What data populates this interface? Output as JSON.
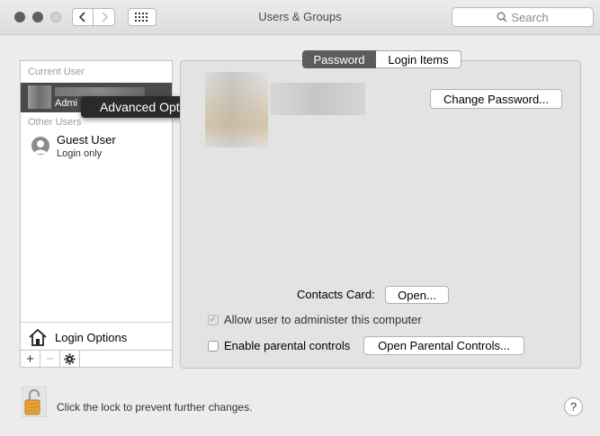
{
  "window": {
    "title": "Users & Groups",
    "search_placeholder": "Search"
  },
  "sidebar": {
    "current_user_header": "Current User",
    "current_user_role": "Admi",
    "other_users_header": "Other Users",
    "guest_name": "Guest User",
    "guest_sub": "Login only",
    "login_options_label": "Login Options",
    "add_symbol": "+",
    "remove_symbol": "−"
  },
  "context_menu": {
    "item": "Advanced Options..."
  },
  "tabs": [
    {
      "label": "Password",
      "active": true
    },
    {
      "label": "Login Items",
      "active": false
    }
  ],
  "panel": {
    "change_password_label": "Change Password...",
    "contacts_card_label": "Contacts Card:",
    "open_label": "Open...",
    "allow_admin_label": "Allow user to administer this computer",
    "allow_admin_checked": true,
    "parental_controls_label": "Enable parental controls",
    "parental_controls_checked": false,
    "open_parental_label": "Open Parental Controls..."
  },
  "footer": {
    "lock_text": "Click the lock to prevent further changes.",
    "help_symbol": "?"
  },
  "colors": {
    "selected_row": "#4a4a4a",
    "active_tab": "#5c5c5c",
    "lock_orange": "#e8a33c"
  }
}
